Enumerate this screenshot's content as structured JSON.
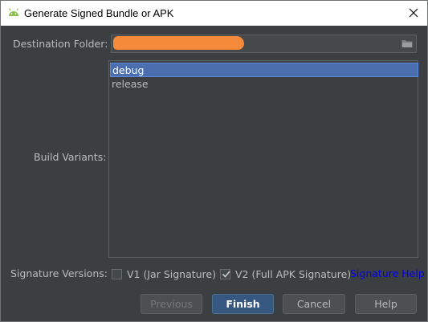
{
  "window": {
    "title": "Generate Signed Bundle or APK",
    "icon": "android-icon",
    "close_icon": "close-icon"
  },
  "form": {
    "destination_label": "Destination Folder:",
    "destination_value_redacted": true,
    "folder_icon": "folder-icon",
    "build_variants_label": "Build Variants:",
    "build_variants": [
      {
        "label": "debug",
        "selected": true
      },
      {
        "label": "release",
        "selected": false
      }
    ],
    "signature_label": "Signature Versions:",
    "v1": {
      "label": "V1 (Jar Signature)",
      "checked": false
    },
    "v2": {
      "label": "V2 (Full APK Signature)",
      "checked": true
    },
    "signature_help": "Signature Help"
  },
  "buttons": {
    "previous": "Previous",
    "finish": "Finish",
    "cancel": "Cancel",
    "help": "Help"
  },
  "colors": {
    "background": "#3c3f41",
    "selection": "#4b6eaf",
    "primary_button": "#365880",
    "link": "#0000ee",
    "redaction": "#f58a3a"
  }
}
